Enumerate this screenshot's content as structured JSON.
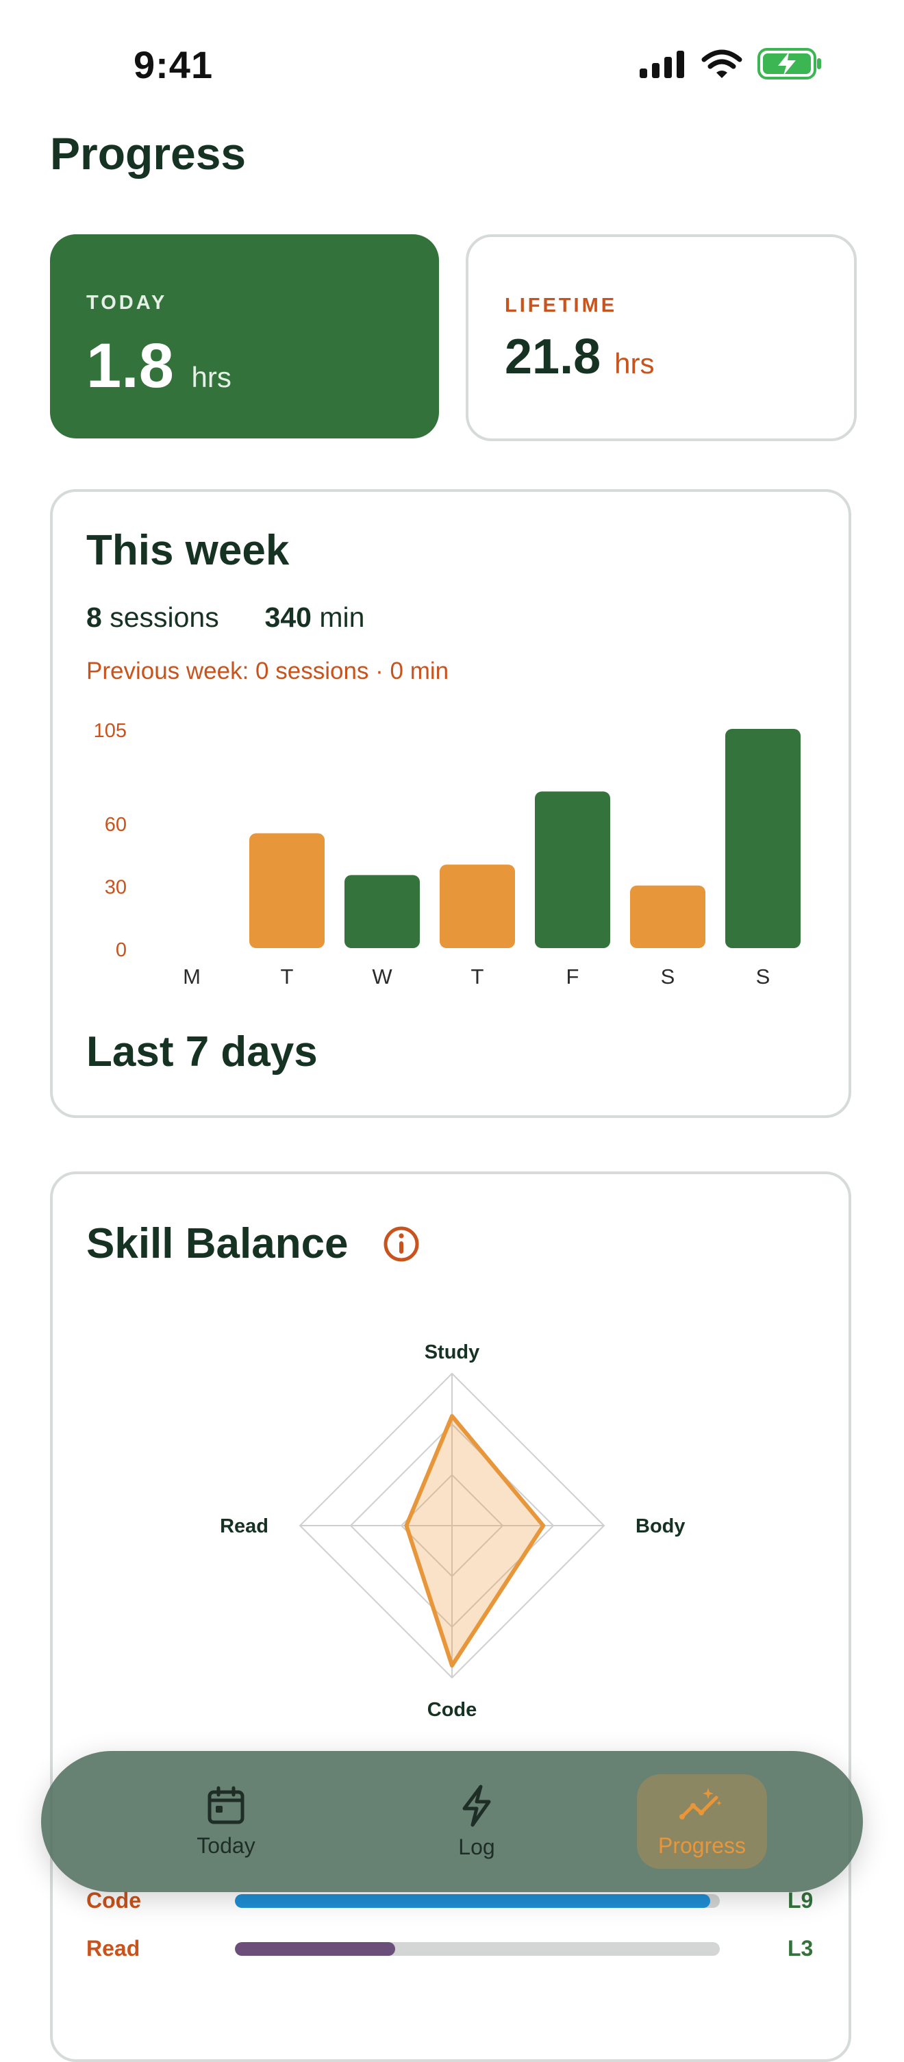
{
  "status_bar": {
    "time": "9:41"
  },
  "page": {
    "title": "Progress"
  },
  "stats": {
    "today": {
      "label": "TODAY",
      "value": "1.8",
      "unit": "hrs"
    },
    "lifetime": {
      "label": "LIFETIME",
      "value": "21.8",
      "unit": "hrs"
    }
  },
  "week": {
    "title": "This week",
    "sessions_count": "8",
    "sessions_label": "sessions",
    "minutes_count": "340",
    "minutes_label": "min",
    "previous": "Previous week: 0 sessions · 0 min",
    "footer": "Last 7 days"
  },
  "chart_data": {
    "type": "bar",
    "categories": [
      "M",
      "T",
      "W",
      "T",
      "F",
      "S",
      "S"
    ],
    "values": [
      0,
      55,
      35,
      40,
      75,
      30,
      105
    ],
    "ylim": [
      0,
      105
    ],
    "yticks": [
      0,
      30,
      60,
      105
    ],
    "colors": [
      "#e8963a",
      "#e8963a",
      "#35733c",
      "#e8963a",
      "#35733c",
      "#e8963a",
      "#35733c"
    ]
  },
  "skills": {
    "title": "Skill Balance",
    "radar": {
      "axes": [
        "Study",
        "Body",
        "Code",
        "Read"
      ],
      "values": [
        0.72,
        0.6,
        0.92,
        0.3
      ],
      "color": "#e8963a"
    },
    "rows": [
      {
        "label": "Code",
        "level": "L9",
        "fraction": 0.98,
        "color": "#1f8fd6"
      },
      {
        "label": "Read",
        "level": "L3",
        "fraction": 0.33,
        "color": "#6b4f7a"
      }
    ]
  },
  "nav": {
    "items": [
      {
        "label": "Today",
        "icon": "calendar-icon"
      },
      {
        "label": "Log",
        "icon": "lightning-icon"
      },
      {
        "label": "Progress",
        "icon": "trend-sparkle-icon"
      }
    ],
    "active_color": "#e8963a"
  }
}
